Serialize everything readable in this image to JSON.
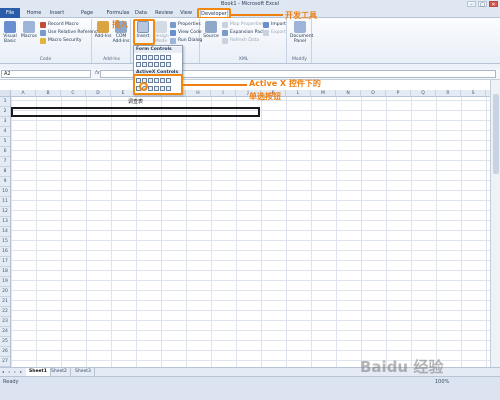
{
  "window": {
    "title": "Book1 - Microsoft Excel",
    "minimize": "–",
    "maximize": "□",
    "close": "✕"
  },
  "tabs": [
    {
      "label": "File"
    },
    {
      "label": "Home"
    },
    {
      "label": "Insert"
    },
    {
      "label": "Page Layout"
    },
    {
      "label": "Formulas"
    },
    {
      "label": "Data"
    },
    {
      "label": "Review"
    },
    {
      "label": "View"
    },
    {
      "label": "Developer"
    }
  ],
  "ribbon": {
    "code": {
      "label": "Code",
      "visual_basic": "Visual Basic",
      "macros": "Macros",
      "record_macro": "Record Macro",
      "relative": "Use Relative References",
      "security": "Macro Security"
    },
    "addins": {
      "label": "Add-Ins",
      "addins": "Add-Ins",
      "com_addins": "COM Add-Ins"
    },
    "controls": {
      "insert": "Insert",
      "design_mode": "Design Mode",
      "properties": "Properties",
      "view_code": "View Code",
      "run_dialog": "Run Dialog"
    },
    "xml": {
      "label": "XML",
      "source": "Source",
      "map_properties": "Map Properties",
      "expansion_packs": "Expansion Packs",
      "refresh_data": "Refresh Data",
      "import": "Import",
      "export": "Export"
    },
    "modify": {
      "label": "Modify",
      "document_panel": "Document Panel"
    }
  },
  "dropdown": {
    "form_controls": "Form Controls",
    "activex_controls": "ActiveX Controls"
  },
  "formula": {
    "namebox": "A2",
    "fx": "fx",
    "value": ""
  },
  "columns": [
    "A",
    "B",
    "C",
    "D",
    "E",
    "F",
    "G",
    "H",
    "I",
    "J",
    "K",
    "L",
    "M",
    "N",
    "O",
    "P",
    "Q",
    "R",
    "S"
  ],
  "rows": [
    "1",
    "2",
    "3",
    "4",
    "5",
    "6",
    "7",
    "8",
    "9",
    "10",
    "11",
    "12",
    "13",
    "14",
    "15",
    "16",
    "17",
    "18",
    "19",
    "20",
    "21",
    "22",
    "23",
    "24",
    "25",
    "26",
    "27"
  ],
  "cells": {
    "title": "调查表"
  },
  "sheets": [
    "Sheet1",
    "Sheet2",
    "Sheet3"
  ],
  "status": {
    "ready": "Ready",
    "zoom": "100%"
  },
  "annotations": {
    "developer": "开发工具",
    "insert": "插入",
    "activex_line1": "Active  X 控件下的",
    "activex_line2": "单选按钮"
  },
  "watermark": "Baidu 经验",
  "colors": {
    "accent": "#ef7e10",
    "file_tab": "#2a5caa",
    "ribbon_bg": "#e9eff7"
  }
}
